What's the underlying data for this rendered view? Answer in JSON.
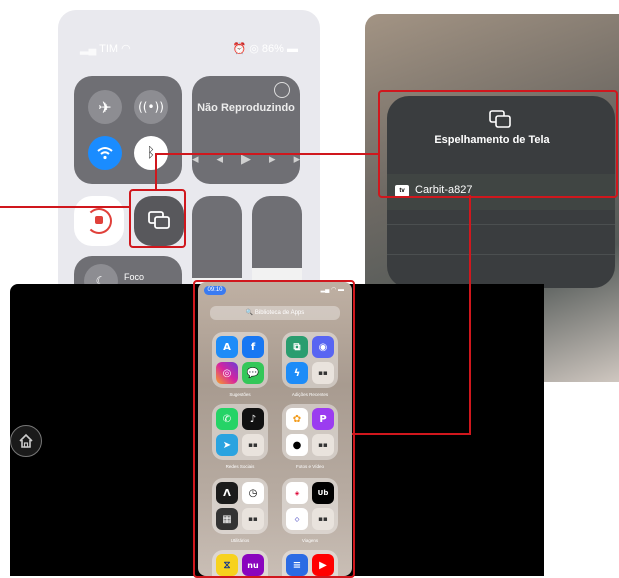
{
  "control_center": {
    "carrier": "TIM",
    "battery": "86%",
    "now_playing_label": "Não Reproduzindo",
    "focus_label": "Foco"
  },
  "mirroring_popup": {
    "title": "Espelhamento de Tela",
    "device_name": "Carbit-a827",
    "device_badge": "tv"
  },
  "phone": {
    "time": "09:10",
    "search_placeholder": "Biblioteca de Apps",
    "folders": [
      "Sugestões",
      "Adições Recentes",
      "Redes Sociais",
      "Fotos e Vídeo",
      "Utilitários",
      "Viagens"
    ]
  },
  "colors": {
    "highlight": "#d0171d",
    "wifi_blue": "#1a8cff",
    "tile_gray": "#6f6f74",
    "mirror_card": "#3a3d3f"
  },
  "icons": [
    "airplane-icon",
    "antenna-icon",
    "wifi-icon",
    "bluetooth-icon",
    "rotation-lock-icon",
    "screen-mirroring-icon",
    "home-icon"
  ]
}
